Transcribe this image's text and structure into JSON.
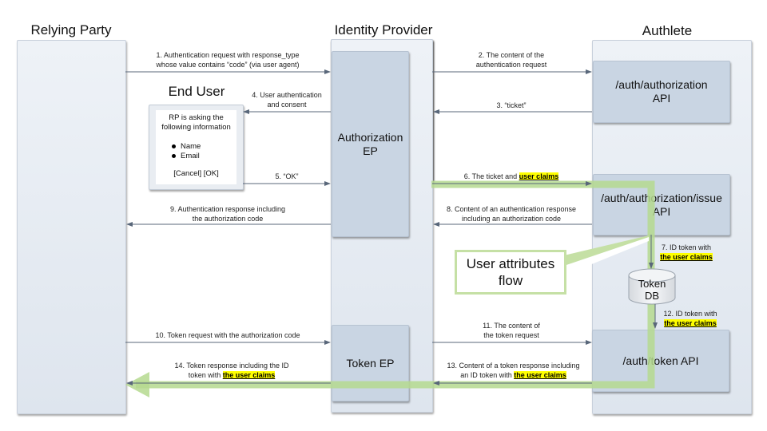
{
  "columns": {
    "relying_party": "Relying Party",
    "identity_provider": "Identity Provider",
    "authlete": "Authlete",
    "end_user": "End User"
  },
  "boxes": {
    "authorization_ep": [
      "Authorization",
      "EP"
    ],
    "token_ep": "Token EP",
    "auth_authorization_api": [
      "/auth/authorization",
      "API"
    ],
    "auth_authorization_issue_api": [
      "/auth/authorization/issue",
      "API"
    ],
    "auth_token_api": "/auth/token API",
    "token_db": [
      "Token",
      "DB"
    ]
  },
  "consent_dialog": {
    "line1": "RP is asking the",
    "line2": "following information",
    "items": [
      "Name",
      "Email"
    ],
    "buttons": "[Cancel] [OK]"
  },
  "callout": [
    "User attributes",
    "flow"
  ],
  "highlight_text": {
    "user_claims": "user claims",
    "the_user_claims": "the user claims"
  },
  "colors": {
    "flow_green": "#b5d98f",
    "highlight": "#ffff00",
    "arrow": "#59677a",
    "box": "#c9d5e3",
    "lane": "#e6ebf2"
  },
  "steps": {
    "s1": [
      "1. Authentication request with response_type",
      "whose value contains “code” (via user agent)"
    ],
    "s2": [
      "2. The content of the",
      "authentication request"
    ],
    "s3": "3. “ticket”",
    "s4": [
      "4. User authentication",
      "and consent"
    ],
    "s5": "5. “OK”",
    "s6": "6. The ticket and ",
    "s7": "7. ID token with",
    "s8": [
      "8. Content of an authentication response",
      "including an authorization code"
    ],
    "s9": [
      "9. Authentication response including",
      "the authorization code"
    ],
    "s10": "10. Token request with the authorization code",
    "s11": [
      "11. The content of",
      "the token request"
    ],
    "s12": "12. ID token with",
    "s13": [
      "13. Content of a token response including",
      "an ID token with "
    ],
    "s14": [
      "14. Token response including the ID",
      "token with "
    ]
  }
}
